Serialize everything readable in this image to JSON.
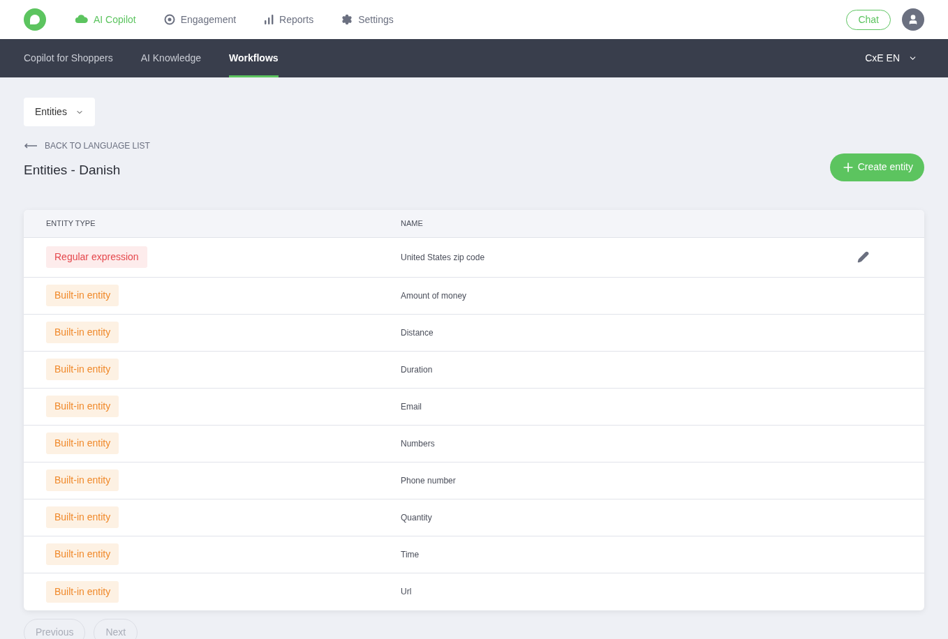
{
  "top_nav": [
    {
      "label": "AI Copilot",
      "selected": true
    },
    {
      "label": "Engagement",
      "selected": false
    },
    {
      "label": "Reports",
      "selected": false
    },
    {
      "label": "Settings",
      "selected": false
    }
  ],
  "chat_button": "Chat",
  "sub_nav": [
    {
      "label": "Copilot for Shoppers",
      "selected": false
    },
    {
      "label": "AI Knowledge",
      "selected": false
    },
    {
      "label": "Workflows",
      "selected": true
    }
  ],
  "account_selector": "CxE EN",
  "view_dropdown": "Entities",
  "back_link": "BACK TO LANGUAGE LIST",
  "page_title": "Entities - Danish",
  "create_button": "Create entity",
  "table": {
    "columns": [
      "ENTITY TYPE",
      "NAME"
    ],
    "rows": [
      {
        "type": "Regular expression",
        "kind": "regex",
        "name": "United States zip code",
        "editable": true
      },
      {
        "type": "Built-in entity",
        "kind": "builtin",
        "name": "Amount of money",
        "editable": false
      },
      {
        "type": "Built-in entity",
        "kind": "builtin",
        "name": "Distance",
        "editable": false
      },
      {
        "type": "Built-in entity",
        "kind": "builtin",
        "name": "Duration",
        "editable": false
      },
      {
        "type": "Built-in entity",
        "kind": "builtin",
        "name": "Email",
        "editable": false
      },
      {
        "type": "Built-in entity",
        "kind": "builtin",
        "name": "Numbers",
        "editable": false
      },
      {
        "type": "Built-in entity",
        "kind": "builtin",
        "name": "Phone number",
        "editable": false
      },
      {
        "type": "Built-in entity",
        "kind": "builtin",
        "name": "Quantity",
        "editable": false
      },
      {
        "type": "Built-in entity",
        "kind": "builtin",
        "name": "Time",
        "editable": false
      },
      {
        "type": "Built-in entity",
        "kind": "builtin",
        "name": "Url",
        "editable": false
      }
    ]
  },
  "pagination": [
    {
      "label": "Previous",
      "disabled": true
    },
    {
      "label": "Next",
      "disabled": true
    }
  ]
}
